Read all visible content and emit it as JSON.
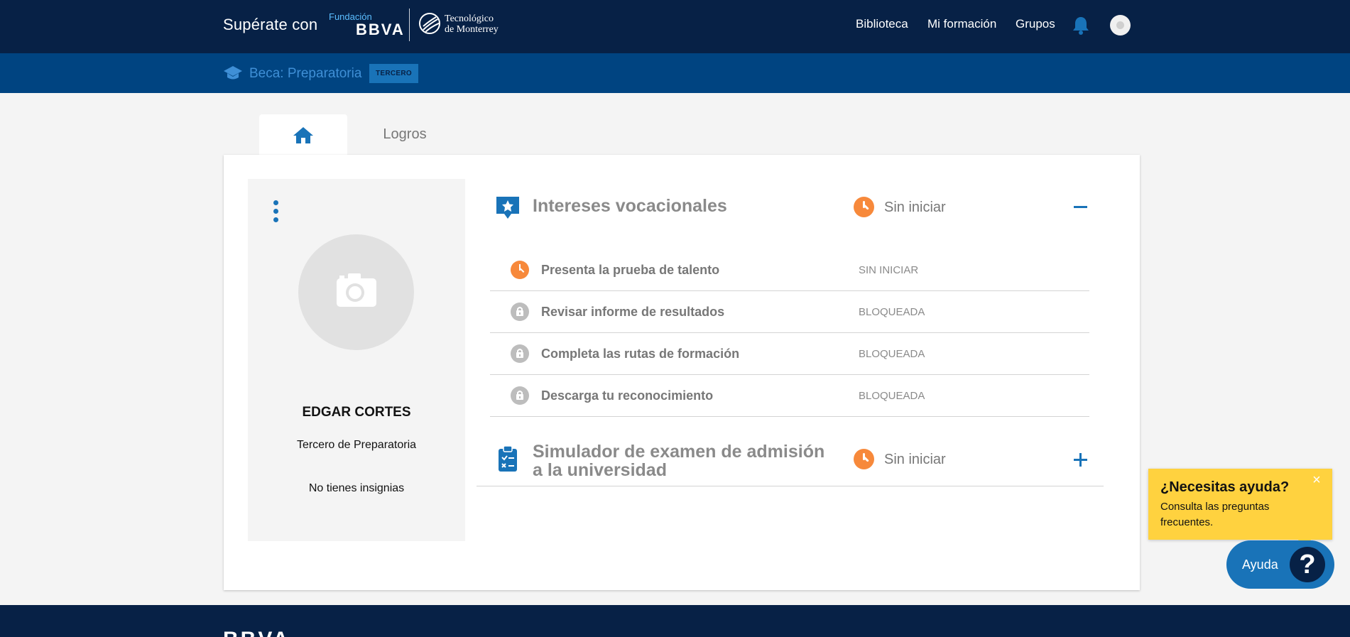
{
  "header": {
    "brand": "Supérate con",
    "fundacion_small": "Fundación",
    "fundacion_bbva": "BBVA",
    "tec_line1": "Tecnológico",
    "tec_line2": "de Monterrey",
    "nav": [
      "Biblioteca",
      "Mi formación",
      "Grupos"
    ],
    "icons": {
      "bell": "bell-icon",
      "avatar": "user-avatar"
    }
  },
  "subheader": {
    "beca": "Beca: Preparatoria",
    "badge": "TERCERO"
  },
  "tabs": {
    "home_icon": "home-icon",
    "logros": "Logros"
  },
  "profile": {
    "name": "EDGAR CORTES",
    "grade": "Tercero de Preparatoria",
    "badges": "No tienes insignias",
    "photo_icon": "camera-icon"
  },
  "sections": [
    {
      "title": "Intereses vocacionales",
      "status": "Sin iniciar",
      "expanded": true,
      "tasks": [
        {
          "label": "Presenta la prueba de talento",
          "status": "SIN INICIAR",
          "icon": "clock-icon"
        },
        {
          "label": "Revisar informe de resultados",
          "status": "BLOQUEADA",
          "icon": "lock-icon"
        },
        {
          "label": "Completa las rutas de formación",
          "status": "BLOQUEADA",
          "icon": "lock-icon"
        },
        {
          "label": "Descarga tu reconocimiento",
          "status": "BLOQUEADA",
          "icon": "lock-icon"
        }
      ]
    },
    {
      "title_line1": "Simulador de examen de admisión",
      "title_line2": "a la universidad",
      "status": "Sin iniciar",
      "expanded": false
    }
  ],
  "help": {
    "title": "¿Necesitas ayuda?",
    "subtitle": "Consulta las preguntas frecuentes.",
    "close": "×",
    "button": "Ayuda",
    "q": "?"
  },
  "footer": {
    "logo": "BBVA"
  },
  "colors": {
    "navy": "#072146",
    "subbar": "#004481",
    "accent": "#1973b8",
    "orange": "#f7893b",
    "yellow": "#ffd23f"
  }
}
